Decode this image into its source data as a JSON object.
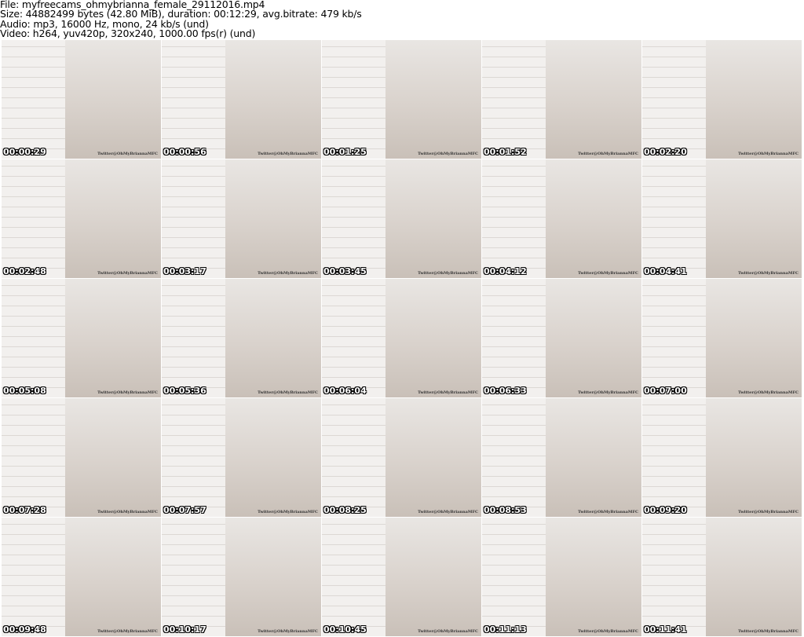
{
  "header": {
    "file": "File: myfreecams_ohmybrianna_female_29112016.mp4",
    "size": "Size: 44882499 bytes (42.80 MiB), duration: 00:12:29, avg.bitrate: 479 kb/s",
    "audio": "Audio: mp3, 16000 Hz, mono, 24 kb/s (und)",
    "video": "Video: h264, yuv420p, 320x240, 1000.00 fps(r) (und)"
  },
  "watermark": "Twitter@OhMyBriannaMFC",
  "thumbnails": [
    "00:00:29",
    "00:00:56",
    "00:01:25",
    "00:01:52",
    "00:02:20",
    "00:02:48",
    "00:03:17",
    "00:03:45",
    "00:04:12",
    "00:04:41",
    "00:05:08",
    "00:05:36",
    "00:06:04",
    "00:06:33",
    "00:07:00",
    "00:07:28",
    "00:07:57",
    "00:08:25",
    "00:08:53",
    "00:09:20",
    "00:09:48",
    "00:10:17",
    "00:10:45",
    "00:11:13",
    "00:11:41"
  ]
}
